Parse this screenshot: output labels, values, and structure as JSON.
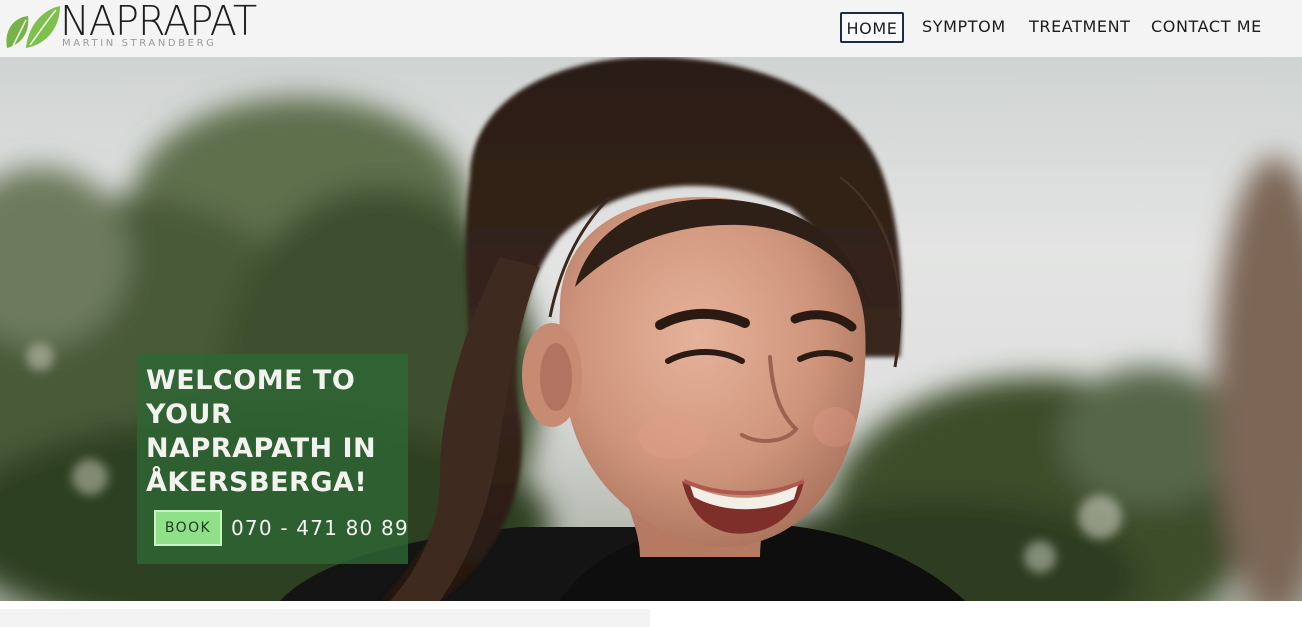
{
  "logo": {
    "title": "NAPRAPAT",
    "subtitle": "MARTIN STRANDBERG",
    "icon": "leaf-icon",
    "leaf_color": "#7ab648"
  },
  "nav": {
    "items": [
      {
        "label": "HOME",
        "active": true
      },
      {
        "label": "SYMPTOM",
        "active": false
      },
      {
        "label": "TREATMENT",
        "active": false
      },
      {
        "label": "CONTACT ME",
        "active": false
      }
    ]
  },
  "hero": {
    "image": "smiling-woman-outdoors-photo",
    "headline": "WELCOME TO YOUR NAPRAPATH IN ÅKERSBERGA!",
    "book_label": "BOOK",
    "phone": "070 - 471 80 89",
    "box_color": "#2d6634",
    "button_color": "#8fe089"
  }
}
